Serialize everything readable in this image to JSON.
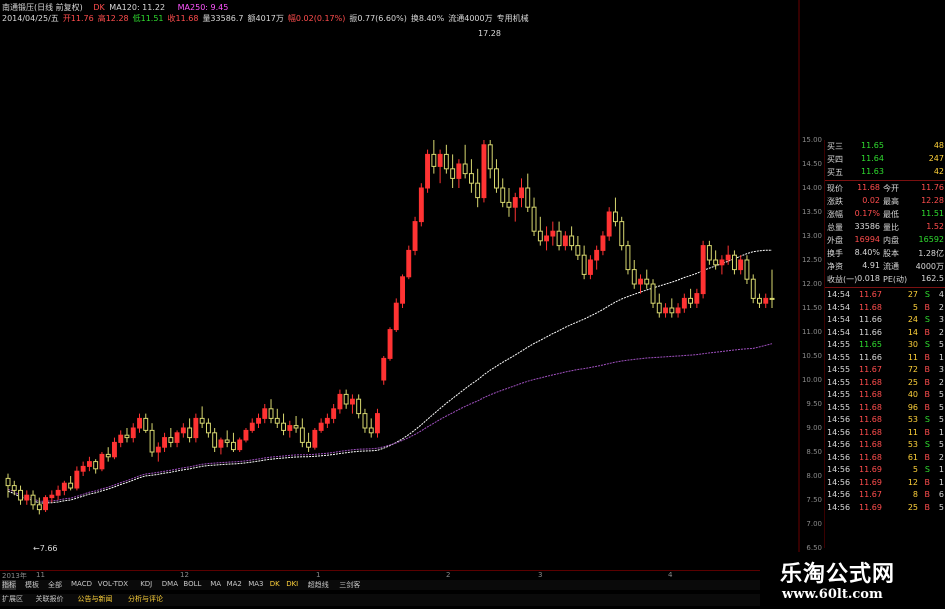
{
  "header": {
    "title": "南通锻压(日线 前复权)",
    "ma_dk": "DK",
    "ma120": "MA120: 11.22",
    "ma250": "MA250: 9.45",
    "line2": [
      {
        "t": "2014/04/25/五",
        "c": "w"
      },
      {
        "t": "开11.76",
        "c": "r"
      },
      {
        "t": "高12.28",
        "c": "r"
      },
      {
        "t": "低11.51",
        "c": "g"
      },
      {
        "t": "收11.68",
        "c": "r"
      },
      {
        "t": "量33586.7",
        "c": "w"
      },
      {
        "t": "额4017万",
        "c": "w"
      },
      {
        "t": "幅0.02(0.17%)",
        "c": "r"
      },
      {
        "t": "振0.77(6.60%)",
        "c": "w"
      },
      {
        "t": "换8.40%",
        "c": "w"
      },
      {
        "t": "流通4000万",
        "c": "w"
      },
      {
        "t": "专用机械",
        "c": "w"
      }
    ]
  },
  "chart_labels": {
    "high": "17.28",
    "low": "7.66"
  },
  "price_ticks": [
    "15.00",
    "14.50",
    "14.00",
    "13.50",
    "13.00",
    "12.50",
    "12.00",
    "11.50",
    "11.00",
    "10.50",
    "10.00",
    "9.50",
    "9.00",
    "8.50",
    "8.00",
    "7.50",
    "7.00",
    "6.50"
  ],
  "x_labels": [
    "2013年",
    "11",
    "12",
    "1",
    "2",
    "3",
    "4"
  ],
  "quote": {
    "asks": [
      {
        "label": "买三",
        "price": "11.65",
        "vol": "48"
      },
      {
        "label": "买四",
        "price": "11.64",
        "vol": "247"
      },
      {
        "label": "买五",
        "price": "11.63",
        "vol": "42"
      }
    ],
    "stats": [
      {
        "l1": "现价",
        "v1": "11.68",
        "c1": "r",
        "l2": "今开",
        "v2": "11.76",
        "c2": "r"
      },
      {
        "l1": "涨跌",
        "v1": "0.02",
        "c1": "r",
        "l2": "最高",
        "v2": "12.28",
        "c2": "r"
      },
      {
        "l1": "涨幅",
        "v1": "0.17%",
        "c1": "r",
        "l2": "最低",
        "v2": "11.51",
        "c2": "g"
      },
      {
        "l1": "总量",
        "v1": "33586",
        "c1": "w",
        "l2": "量比",
        "v2": "1.52",
        "c2": "r"
      },
      {
        "l1": "外盘",
        "v1": "16994",
        "c1": "r",
        "l2": "内盘",
        "v2": "16592",
        "c2": "g"
      },
      {
        "l1": "换手",
        "v1": "8.40%",
        "c1": "w",
        "l2": "股本",
        "v2": "1.28亿",
        "c2": "w"
      },
      {
        "l1": "净资",
        "v1": "4.91",
        "c1": "w",
        "l2": "流通",
        "v2": "4000万",
        "c2": "w"
      },
      {
        "l1": "收益(一)",
        "v1": "0.018",
        "c1": "w",
        "l2": "PE(动)",
        "v2": "162.5",
        "c2": "w"
      }
    ],
    "ticks": [
      {
        "time": "14:54",
        "price": "11.67",
        "pc": "r",
        "vol": "27",
        "side": "S",
        "n": "4"
      },
      {
        "time": "14:54",
        "price": "11.68",
        "pc": "r",
        "vol": "5",
        "side": "B",
        "n": "2"
      },
      {
        "time": "14:54",
        "price": "11.66",
        "pc": "w",
        "vol": "24",
        "side": "S",
        "n": "3"
      },
      {
        "time": "14:54",
        "price": "11.66",
        "pc": "w",
        "vol": "14",
        "side": "B",
        "n": "2"
      },
      {
        "time": "14:55",
        "price": "11.65",
        "pc": "g",
        "vol": "30",
        "side": "S",
        "n": "5"
      },
      {
        "time": "14:55",
        "price": "11.66",
        "pc": "w",
        "vol": "11",
        "side": "B",
        "n": "1"
      },
      {
        "time": "14:55",
        "price": "11.67",
        "pc": "r",
        "vol": "72",
        "side": "B",
        "n": "3"
      },
      {
        "time": "14:55",
        "price": "11.68",
        "pc": "r",
        "vol": "25",
        "side": "B",
        "n": "2"
      },
      {
        "time": "14:55",
        "price": "11.68",
        "pc": "r",
        "vol": "40",
        "side": "B",
        "n": "5"
      },
      {
        "time": "14:55",
        "price": "11.68",
        "pc": "r",
        "vol": "96",
        "side": "B",
        "n": "5"
      },
      {
        "time": "14:56",
        "price": "11.68",
        "pc": "r",
        "vol": "53",
        "side": "S",
        "n": "5"
      },
      {
        "time": "14:56",
        "price": "11.68",
        "pc": "r",
        "vol": "11",
        "side": "B",
        "n": "1"
      },
      {
        "time": "14:56",
        "price": "11.68",
        "pc": "r",
        "vol": "53",
        "side": "S",
        "n": "5"
      },
      {
        "time": "14:56",
        "price": "11.68",
        "pc": "r",
        "vol": "61",
        "side": "B",
        "n": "2"
      },
      {
        "time": "14:56",
        "price": "11.69",
        "pc": "r",
        "vol": "5",
        "side": "S",
        "n": "1"
      },
      {
        "time": "14:56",
        "price": "11.69",
        "pc": "r",
        "vol": "12",
        "side": "B",
        "n": "1"
      },
      {
        "time": "14:56",
        "price": "11.67",
        "pc": "r",
        "vol": "8",
        "side": "B",
        "n": "6"
      },
      {
        "time": "14:56",
        "price": "11.69",
        "pc": "r",
        "vol": "25",
        "side": "B",
        "n": "5"
      }
    ]
  },
  "bottom_tabs1": [
    "指标",
    "模板",
    "全部",
    "MACD",
    "VOL-TDX",
    "KDJ",
    "DMA",
    "BOLL",
    "MA",
    "MA2",
    "MA3",
    "DK",
    "DKI",
    "超趋线",
    "三剑客"
  ],
  "bottom_tabs2": [
    "扩展区",
    "关联报价",
    "公告与新闻",
    "分析与评论"
  ],
  "watermark": {
    "cn": "乐淘公式网",
    "url": "www.60lt.com"
  },
  "colors": {
    "up": "#ff3333",
    "down": "#d8d870",
    "ma_dk": "#ffffff",
    "ma250": "#a050c0",
    "bg": "#000000"
  },
  "chart_data": {
    "type": "candlestick",
    "ylim": [
      6.5,
      15.0
    ],
    "note_high": "17.28",
    "note_low": "7.66",
    "candles": [
      [
        7.95,
        8.05,
        7.55,
        7.8
      ],
      [
        7.8,
        7.9,
        7.6,
        7.7
      ],
      [
        7.7,
        7.8,
        7.4,
        7.5
      ],
      [
        7.5,
        7.7,
        7.4,
        7.6
      ],
      [
        7.6,
        7.7,
        7.3,
        7.4
      ],
      [
        7.4,
        7.55,
        7.2,
        7.3
      ],
      [
        7.3,
        7.6,
        7.25,
        7.55
      ],
      [
        7.55,
        7.7,
        7.45,
        7.6
      ],
      [
        7.6,
        7.8,
        7.5,
        7.7
      ],
      [
        7.7,
        7.9,
        7.6,
        7.85
      ],
      [
        7.85,
        8.0,
        7.7,
        7.75
      ],
      [
        7.75,
        8.2,
        7.7,
        8.1
      ],
      [
        8.1,
        8.3,
        8.0,
        8.2
      ],
      [
        8.2,
        8.4,
        8.1,
        8.3
      ],
      [
        8.3,
        8.35,
        8.05,
        8.15
      ],
      [
        8.15,
        8.5,
        8.1,
        8.45
      ],
      [
        8.45,
        8.6,
        8.3,
        8.4
      ],
      [
        8.4,
        8.8,
        8.35,
        8.7
      ],
      [
        8.7,
        8.95,
        8.6,
        8.85
      ],
      [
        8.85,
        9.0,
        8.7,
        8.8
      ],
      [
        8.8,
        9.1,
        8.7,
        9.0
      ],
      [
        9.0,
        9.3,
        8.9,
        9.2
      ],
      [
        9.2,
        9.3,
        8.9,
        8.95
      ],
      [
        8.95,
        9.1,
        8.4,
        8.5
      ],
      [
        8.5,
        8.7,
        8.3,
        8.6
      ],
      [
        8.6,
        8.9,
        8.5,
        8.8
      ],
      [
        8.8,
        9.0,
        8.6,
        8.7
      ],
      [
        8.7,
        8.95,
        8.6,
        8.9
      ],
      [
        8.9,
        9.1,
        8.8,
        9.0
      ],
      [
        9.0,
        9.2,
        8.7,
        8.8
      ],
      [
        8.8,
        9.3,
        8.7,
        9.2
      ],
      [
        9.2,
        9.45,
        9.0,
        9.1
      ],
      [
        9.1,
        9.2,
        8.8,
        8.9
      ],
      [
        8.9,
        9.0,
        8.5,
        8.6
      ],
      [
        8.6,
        8.8,
        8.45,
        8.75
      ],
      [
        8.75,
        8.95,
        8.6,
        8.7
      ],
      [
        8.7,
        8.9,
        8.5,
        8.55
      ],
      [
        8.55,
        8.8,
        8.5,
        8.75
      ],
      [
        8.75,
        9.0,
        8.7,
        8.95
      ],
      [
        8.95,
        9.2,
        8.9,
        9.1
      ],
      [
        9.1,
        9.3,
        9.0,
        9.2
      ],
      [
        9.2,
        9.5,
        9.1,
        9.4
      ],
      [
        9.4,
        9.6,
        9.1,
        9.2
      ],
      [
        9.2,
        9.4,
        9.0,
        9.1
      ],
      [
        9.1,
        9.3,
        8.85,
        8.95
      ],
      [
        8.95,
        9.15,
        8.8,
        9.05
      ],
      [
        9.05,
        9.25,
        8.9,
        9.0
      ],
      [
        9.0,
        9.2,
        8.6,
        8.7
      ],
      [
        8.7,
        8.9,
        8.5,
        8.6
      ],
      [
        8.6,
        9.0,
        8.55,
        8.95
      ],
      [
        8.95,
        9.2,
        8.9,
        9.1
      ],
      [
        9.1,
        9.3,
        9.0,
        9.2
      ],
      [
        9.2,
        9.5,
        9.1,
        9.4
      ],
      [
        9.4,
        9.8,
        9.3,
        9.7
      ],
      [
        9.7,
        9.8,
        9.4,
        9.5
      ],
      [
        9.5,
        9.7,
        9.3,
        9.6
      ],
      [
        9.6,
        9.7,
        9.2,
        9.3
      ],
      [
        9.3,
        9.4,
        8.9,
        9.0
      ],
      [
        9.0,
        9.2,
        8.8,
        8.9
      ],
      [
        8.9,
        9.4,
        8.8,
        9.3
      ],
      [
        10.0,
        10.5,
        9.9,
        10.45
      ],
      [
        10.45,
        11.1,
        10.4,
        11.05
      ],
      [
        11.05,
        11.7,
        11.0,
        11.6
      ],
      [
        11.6,
        12.2,
        11.5,
        12.15
      ],
      [
        12.15,
        12.8,
        12.1,
        12.7
      ],
      [
        12.7,
        13.4,
        12.6,
        13.3
      ],
      [
        13.3,
        14.1,
        13.2,
        14.0
      ],
      [
        14.0,
        14.8,
        13.9,
        14.7
      ],
      [
        14.7,
        15.0,
        14.3,
        14.45
      ],
      [
        14.45,
        14.8,
        14.1,
        14.7
      ],
      [
        14.7,
        14.9,
        14.3,
        14.4
      ],
      [
        14.4,
        14.7,
        14.0,
        14.2
      ],
      [
        14.2,
        14.6,
        14.0,
        14.5
      ],
      [
        14.5,
        14.9,
        14.2,
        14.3
      ],
      [
        14.3,
        14.6,
        13.9,
        14.1
      ],
      [
        14.1,
        14.4,
        13.6,
        13.8
      ],
      [
        13.8,
        15.0,
        13.7,
        14.9
      ],
      [
        14.9,
        15.0,
        14.2,
        14.4
      ],
      [
        14.4,
        14.6,
        13.9,
        14.0
      ],
      [
        14.0,
        14.2,
        13.6,
        13.7
      ],
      [
        13.7,
        14.0,
        13.4,
        13.6
      ],
      [
        13.6,
        13.9,
        13.3,
        13.8
      ],
      [
        13.8,
        14.2,
        13.6,
        14.0
      ],
      [
        14.0,
        14.3,
        13.5,
        13.6
      ],
      [
        13.6,
        13.8,
        13.0,
        13.1
      ],
      [
        13.1,
        13.4,
        12.8,
        12.9
      ],
      [
        12.9,
        13.2,
        12.7,
        13.0
      ],
      [
        13.0,
        13.3,
        12.8,
        13.1
      ],
      [
        13.1,
        13.3,
        12.7,
        12.8
      ],
      [
        12.8,
        13.1,
        12.7,
        13.0
      ],
      [
        13.0,
        13.2,
        12.7,
        12.8
      ],
      [
        12.8,
        13.0,
        12.5,
        12.6
      ],
      [
        12.6,
        12.8,
        12.1,
        12.2
      ],
      [
        12.2,
        12.6,
        12.1,
        12.5
      ],
      [
        12.5,
        12.8,
        12.3,
        12.7
      ],
      [
        12.7,
        13.1,
        12.6,
        13.0
      ],
      [
        13.0,
        13.6,
        12.9,
        13.5
      ],
      [
        13.5,
        13.8,
        13.2,
        13.3
      ],
      [
        13.3,
        13.4,
        12.7,
        12.8
      ],
      [
        12.8,
        12.9,
        12.2,
        12.3
      ],
      [
        12.3,
        12.5,
        11.9,
        12.0
      ],
      [
        12.0,
        12.2,
        11.8,
        12.1
      ],
      [
        12.1,
        12.3,
        11.9,
        12.0
      ],
      [
        12.0,
        12.1,
        11.5,
        11.6
      ],
      [
        11.6,
        11.8,
        11.3,
        11.4
      ],
      [
        11.4,
        11.6,
        11.3,
        11.5
      ],
      [
        11.5,
        11.7,
        11.3,
        11.4
      ],
      [
        11.4,
        11.6,
        11.3,
        11.5
      ],
      [
        11.5,
        11.8,
        11.4,
        11.7
      ],
      [
        11.7,
        11.9,
        11.5,
        11.6
      ],
      [
        11.6,
        11.9,
        11.5,
        11.8
      ],
      [
        11.8,
        12.9,
        11.7,
        12.8
      ],
      [
        12.8,
        12.9,
        12.4,
        12.5
      ],
      [
        12.5,
        12.7,
        12.3,
        12.4
      ],
      [
        12.4,
        12.6,
        12.2,
        12.5
      ],
      [
        12.5,
        12.8,
        12.4,
        12.6
      ],
      [
        12.6,
        12.7,
        12.2,
        12.3
      ],
      [
        12.3,
        12.6,
        12.2,
        12.5
      ],
      [
        12.5,
        12.6,
        12.0,
        12.1
      ],
      [
        12.1,
        12.2,
        11.6,
        11.7
      ],
      [
        11.7,
        11.8,
        11.5,
        11.6
      ],
      [
        11.6,
        11.8,
        11.5,
        11.7
      ],
      [
        11.7,
        12.3,
        11.5,
        11.68
      ]
    ]
  }
}
